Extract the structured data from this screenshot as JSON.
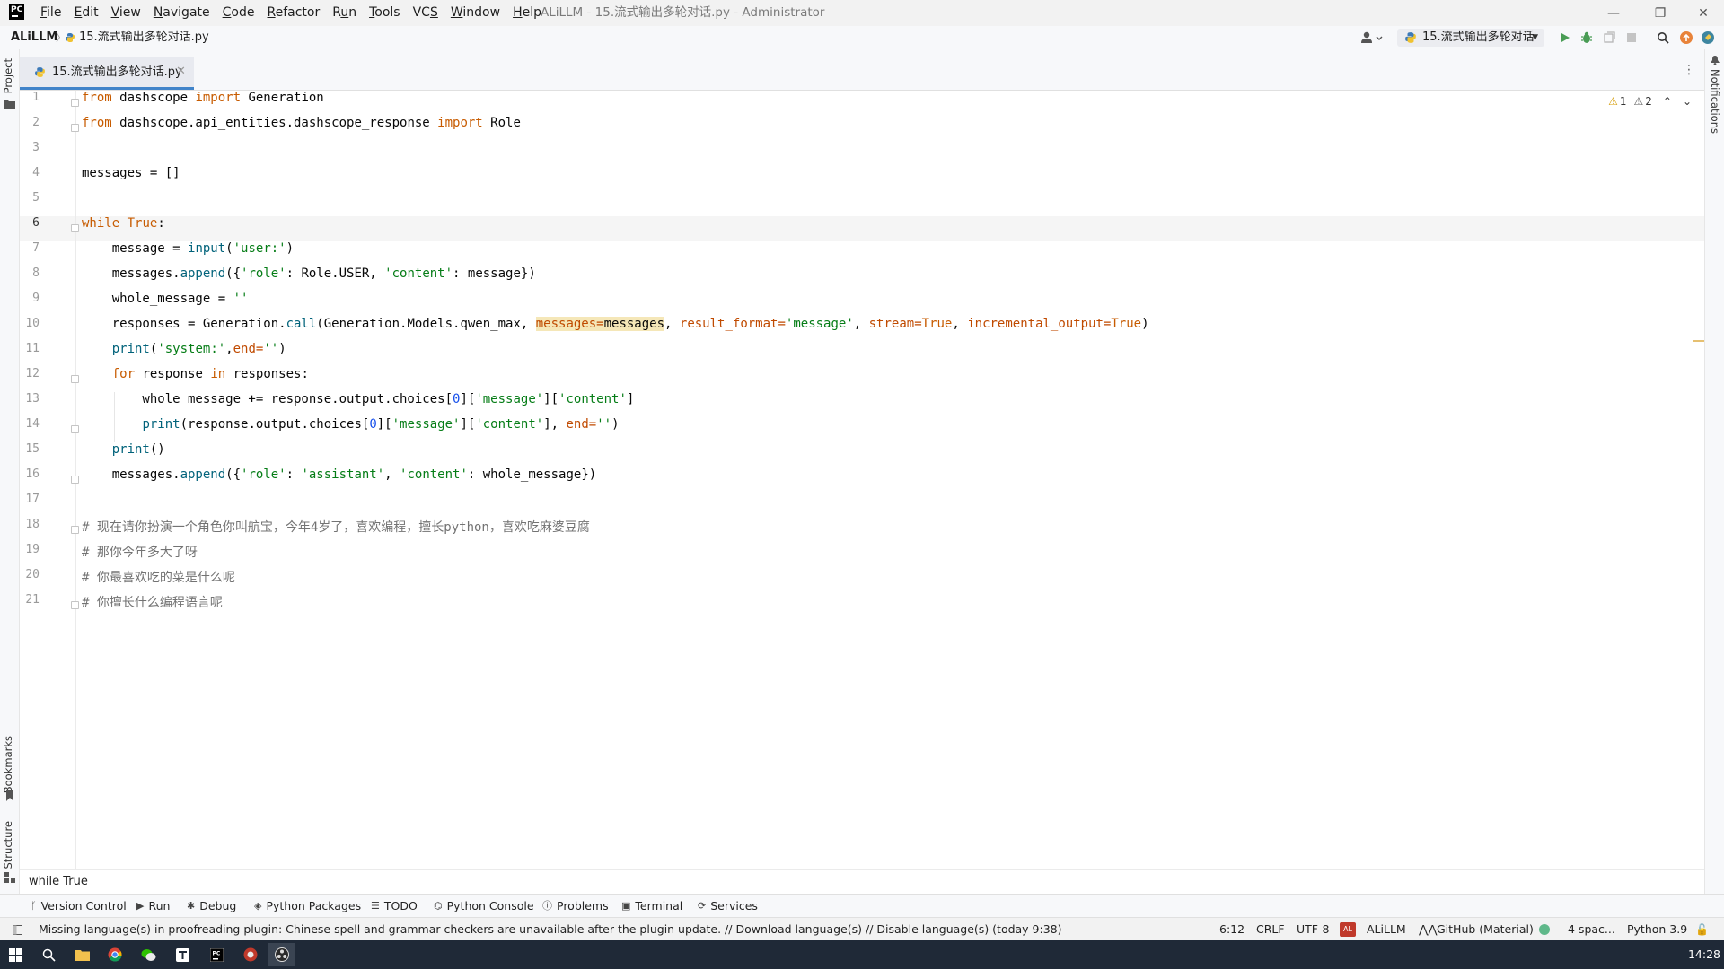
{
  "window": {
    "title": "ALiLLM - 15.流式输出多轮对话.py - Administrator",
    "minimize": "—",
    "restore": "❐",
    "close": "✕"
  },
  "menu": [
    {
      "pre": "",
      "u": "F",
      "post": "ile"
    },
    {
      "pre": "",
      "u": "E",
      "post": "dit"
    },
    {
      "pre": "",
      "u": "V",
      "post": "iew"
    },
    {
      "pre": "",
      "u": "N",
      "post": "avigate"
    },
    {
      "pre": "",
      "u": "C",
      "post": "ode"
    },
    {
      "pre": "",
      "u": "R",
      "post": "efactor"
    },
    {
      "pre": "R",
      "u": "u",
      "post": "n"
    },
    {
      "pre": "",
      "u": "T",
      "post": "ools"
    },
    {
      "pre": "VC",
      "u": "S",
      "post": ""
    },
    {
      "pre": "",
      "u": "W",
      "post": "indow"
    },
    {
      "pre": "",
      "u": "H",
      "post": "elp"
    }
  ],
  "logo": "PC",
  "navbar": {
    "project": "ALiLLM",
    "separator": "〉",
    "file": "15.流式输出多轮对话.py",
    "run_config": "15.流式输出多轮对话"
  },
  "side_tabs": {
    "project": "Project",
    "bookmarks": "Bookmarks",
    "structure": "Structure",
    "notifications": "Notifications"
  },
  "editor_tab": {
    "label": "15.流式输出多轮对话.py",
    "close": "✕"
  },
  "inspection": {
    "warnings": "1",
    "weak_warnings": "2"
  },
  "current_line": 6,
  "code_lines": [
    [
      {
        "t": "kw2",
        "v": "from"
      },
      {
        "t": "",
        "v": " dashscope "
      },
      {
        "t": "kw2",
        "v": "import"
      },
      {
        "t": "",
        "v": " Generation"
      }
    ],
    [
      {
        "t": "kw2",
        "v": "from"
      },
      {
        "t": "",
        "v": " dashscope.api_entities.dashscope_response "
      },
      {
        "t": "kw2",
        "v": "import"
      },
      {
        "t": "",
        "v": " Role"
      }
    ],
    [],
    [
      {
        "t": "",
        "v": "messages = []"
      }
    ],
    [],
    [
      {
        "t": "kw2",
        "v": "while"
      },
      {
        "t": "",
        "v": " "
      },
      {
        "t": "kw2",
        "v": "True"
      },
      {
        "t": "",
        "v": ":"
      }
    ],
    [
      {
        "t": "",
        "v": "    message = "
      },
      {
        "t": "fn",
        "v": "input"
      },
      {
        "t": "",
        "v": "("
      },
      {
        "t": "str",
        "v": "'user:'"
      },
      {
        "t": "",
        "v": ")"
      }
    ],
    [
      {
        "t": "",
        "v": "    messages."
      },
      {
        "t": "fn",
        "v": "append"
      },
      {
        "t": "",
        "v": "({"
      },
      {
        "t": "str",
        "v": "'role'"
      },
      {
        "t": "",
        "v": ": Role.USER, "
      },
      {
        "t": "str",
        "v": "'content'"
      },
      {
        "t": "",
        "v": ": message})"
      }
    ],
    [
      {
        "t": "",
        "v": "    whole_message = "
      },
      {
        "t": "str",
        "v": "''"
      }
    ],
    [
      {
        "t": "",
        "v": "    responses = Generation."
      },
      {
        "t": "fn",
        "v": "call"
      },
      {
        "t": "",
        "v": "(Generation.Models.qwen_max, "
      },
      {
        "t": "param hl",
        "v": "messages="
      },
      {
        "t": "hl",
        "v": "messages"
      },
      {
        "t": "",
        "v": ", "
      },
      {
        "t": "param",
        "v": "result_format="
      },
      {
        "t": "str",
        "v": "'message'"
      },
      {
        "t": "",
        "v": ", "
      },
      {
        "t": "param",
        "v": "stream="
      },
      {
        "t": "kw2",
        "v": "True"
      },
      {
        "t": "",
        "v": ", "
      },
      {
        "t": "param",
        "v": "incremental_output="
      },
      {
        "t": "kw2",
        "v": "True"
      },
      {
        "t": "",
        "v": ")"
      }
    ],
    [
      {
        "t": "",
        "v": "    "
      },
      {
        "t": "fn",
        "v": "print"
      },
      {
        "t": "",
        "v": "("
      },
      {
        "t": "str",
        "v": "'system:'"
      },
      {
        "t": "",
        "v": ","
      },
      {
        "t": "param",
        "v": "end="
      },
      {
        "t": "str",
        "v": "''"
      },
      {
        "t": "",
        "v": ")"
      }
    ],
    [
      {
        "t": "",
        "v": "    "
      },
      {
        "t": "kw2",
        "v": "for"
      },
      {
        "t": "",
        "v": " response "
      },
      {
        "t": "kw2",
        "v": "in"
      },
      {
        "t": "",
        "v": " responses:"
      }
    ],
    [
      {
        "t": "",
        "v": "        whole_message += response.output.choices["
      },
      {
        "t": "num",
        "v": "0"
      },
      {
        "t": "",
        "v": "]["
      },
      {
        "t": "str",
        "v": "'message'"
      },
      {
        "t": "",
        "v": "]["
      },
      {
        "t": "str",
        "v": "'content'"
      },
      {
        "t": "",
        "v": "]"
      }
    ],
    [
      {
        "t": "",
        "v": "        "
      },
      {
        "t": "fn",
        "v": "print"
      },
      {
        "t": "",
        "v": "(response.output.choices["
      },
      {
        "t": "num",
        "v": "0"
      },
      {
        "t": "",
        "v": "]["
      },
      {
        "t": "str",
        "v": "'message'"
      },
      {
        "t": "",
        "v": "]["
      },
      {
        "t": "str",
        "v": "'content'"
      },
      {
        "t": "",
        "v": "], "
      },
      {
        "t": "param",
        "v": "end="
      },
      {
        "t": "str",
        "v": "''"
      },
      {
        "t": "",
        "v": ")"
      }
    ],
    [
      {
        "t": "",
        "v": "    "
      },
      {
        "t": "fn",
        "v": "print"
      },
      {
        "t": "",
        "v": "()"
      }
    ],
    [
      {
        "t": "",
        "v": "    messages."
      },
      {
        "t": "fn",
        "v": "append"
      },
      {
        "t": "",
        "v": "({"
      },
      {
        "t": "str",
        "v": "'role'"
      },
      {
        "t": "",
        "v": ": "
      },
      {
        "t": "str",
        "v": "'assistant'"
      },
      {
        "t": "",
        "v": ", "
      },
      {
        "t": "str",
        "v": "'content'"
      },
      {
        "t": "",
        "v": ": whole_message})"
      }
    ],
    [],
    [
      {
        "t": "cmt",
        "v": "# 现在请你扮演一个角色你叫航宝，今年4岁了，喜欢编程，擅长python，喜欢吃麻婆豆腐"
      }
    ],
    [
      {
        "t": "cmt",
        "v": "# 那你今年多大了呀"
      }
    ],
    [
      {
        "t": "cmt",
        "v": "# 你最喜欢吃的菜是什么呢"
      }
    ],
    [
      {
        "t": "cmt",
        "v": "# 你擅长什么编程语言呢"
      }
    ]
  ],
  "breadcrumb": "while True",
  "tool_windows": [
    {
      "icon": "branch-icon",
      "glyph": "ᚴ",
      "label": "Version Control"
    },
    {
      "icon": "run-icon",
      "glyph": "▶",
      "label": "Run"
    },
    {
      "icon": "bug-icon",
      "glyph": "✱",
      "label": "Debug"
    },
    {
      "icon": "layers-icon",
      "glyph": "◈",
      "label": "Python Packages"
    },
    {
      "icon": "list-icon",
      "glyph": "☰",
      "label": "TODO"
    },
    {
      "icon": "python-icon",
      "glyph": "⌬",
      "label": "Python Console"
    },
    {
      "icon": "info-icon",
      "glyph": "ⓘ",
      "label": "Problems"
    },
    {
      "icon": "terminal-icon",
      "glyph": "▣",
      "label": "Terminal"
    },
    {
      "icon": "services-icon",
      "glyph": "⟳",
      "label": "Services"
    }
  ],
  "status": {
    "message": "Missing language(s) in proofreading plugin: Chinese spell and grammar checkers are unavailable after the plugin update. // Download language(s) // Disable language(s) (today 9:38)",
    "position": "6:12",
    "line_sep": "CRLF",
    "encoding": "UTF-8",
    "project": "ALiLLM",
    "project_badge": "AL",
    "theme": "GitHub (Material)",
    "indent": "4 spac...",
    "interpreter": "Python 3.9"
  },
  "taskbar": {
    "time": "14:28"
  },
  "colors": {
    "accent": "#4083c9",
    "keyword": "#c75b00",
    "string": "#067d17",
    "comment": "#737373"
  }
}
